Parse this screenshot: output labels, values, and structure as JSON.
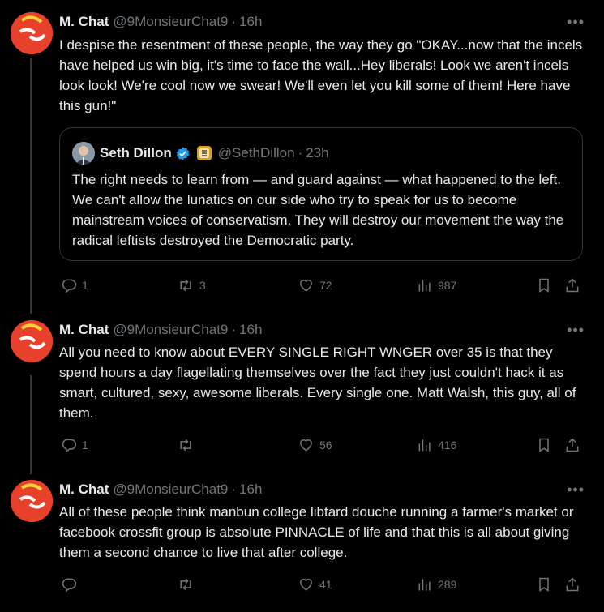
{
  "posts": [
    {
      "name": "M. Chat",
      "handle": "@9MonsieurChat9",
      "time": "16h",
      "text": "I despise the resentment of these people, the way they go \"OKAY...now that the incels have helped us win big, it's time to face the wall...Hey liberals! Look we aren't incels look look! We're cool now we swear! We'll even let you kill some of them! Here have this gun!\"",
      "quote": {
        "name": "Seth Dillon",
        "handle": "@SethDillon",
        "time": "23h",
        "text": "The right needs to learn from — and guard against — what happened to the left. We can't allow the lunatics on our side who try to speak for us to become mainstream voices of conservatism. They will destroy our movement the way the radical leftists destroyed the Democratic party."
      },
      "replies": "1",
      "reposts": "3",
      "likes": "72",
      "views": "987"
    },
    {
      "name": "M. Chat",
      "handle": "@9MonsieurChat9",
      "time": "16h",
      "text": "All you need to know about EVERY SINGLE RIGHT WNGER over 35 is that they spend hours a day flagellating themselves over the fact they just couldn't hack it as smart, cultured, sexy, awesome liberals. Every single one. Matt Walsh, this guy, all of them.",
      "replies": "1",
      "reposts": "",
      "likes": "56",
      "views": "416"
    },
    {
      "name": "M. Chat",
      "handle": "@9MonsieurChat9",
      "time": "16h",
      "text": "All of these people think manbun college libtard douche running a farmer's market or facebook crossfit group is absolute PINNACLE of life and that this is all about giving them a second chance to live that after college.",
      "replies": "",
      "reposts": "",
      "likes": "41",
      "views": "289"
    }
  ],
  "icons": {
    "more": "more-icon",
    "reply": "reply-icon",
    "repost": "repost-icon",
    "like": "heart-icon",
    "views": "views-icon",
    "bookmark": "bookmark-icon",
    "share": "share-icon",
    "verified": "verified-badge-icon",
    "affiliate": "affiliate-badge-icon"
  },
  "colors": {
    "background": "#000000",
    "text": "#e7e9ea",
    "muted": "#71767b",
    "border": "#2f3336",
    "verified": "#1d9bf0",
    "avatar": "#e8412b"
  }
}
